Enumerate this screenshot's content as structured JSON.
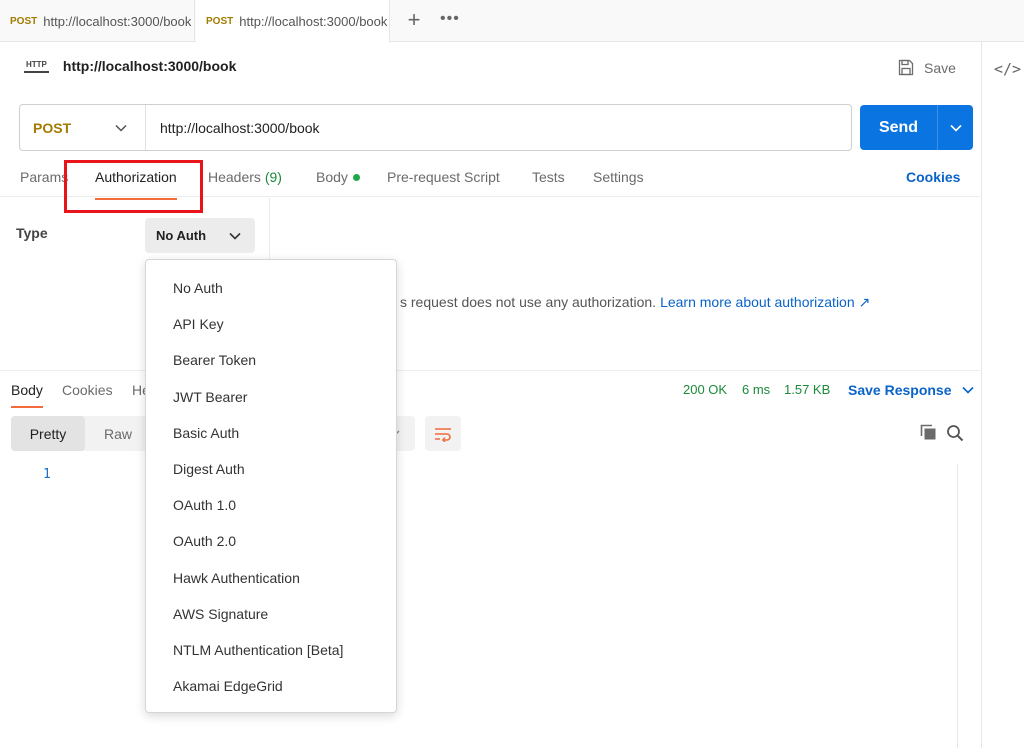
{
  "tabs": [
    {
      "method": "POST",
      "url": "http://localhost:3000/book"
    },
    {
      "method": "POST",
      "url": "http://localhost:3000/book"
    }
  ],
  "tabstrip": {
    "new_tab": "+",
    "more": "•••"
  },
  "request": {
    "title": "http://localhost:3000/book",
    "save_label": "Save",
    "method": "POST",
    "url": "http://localhost:3000/book",
    "send_label": "Send"
  },
  "request_tabs": {
    "params": "Params",
    "authorization": "Authorization",
    "headers": "Headers",
    "headers_count": "(9)",
    "body": "Body",
    "pre_request": "Pre-request Script",
    "tests": "Tests",
    "settings": "Settings",
    "cookies": "Cookies"
  },
  "auth": {
    "type_label": "Type",
    "selected": "No Auth",
    "message": "s request does not use any authorization.",
    "learn_more": "Learn more about authorization ↗"
  },
  "auth_options": [
    "No Auth",
    "API Key",
    "Bearer Token",
    "JWT Bearer",
    "Basic Auth",
    "Digest Auth",
    "OAuth 1.0",
    "OAuth 2.0",
    "Hawk Authentication",
    "AWS Signature",
    "NTLM Authentication [Beta]",
    "Akamai EdgeGrid"
  ],
  "response": {
    "tabs": {
      "body": "Body",
      "cookies": "Cookies",
      "headers_partial": "He"
    },
    "status": "200 OK",
    "time": "6 ms",
    "size": "1.57 KB",
    "save_response": "Save Response",
    "format_pretty": "Pretty",
    "format_raw": "Raw",
    "line_number": "1"
  },
  "colors": {
    "accent": "#0a75e0",
    "method_post": "#a37b00",
    "tab_underline": "#f26b3a",
    "status_ok": "#1b8a3a",
    "highlight": "#e8141a"
  }
}
